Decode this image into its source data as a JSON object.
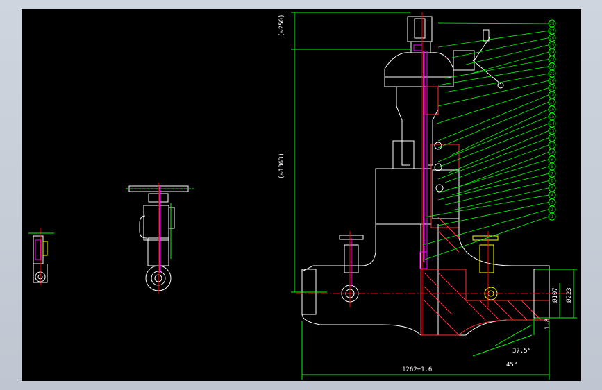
{
  "drawing": {
    "background": "#000000",
    "colors": {
      "outline": "#ffffff",
      "dimension": "#00ff00",
      "centerline": "#ff0000",
      "stem": "#ff00ff",
      "hatch": "#ff3030",
      "highlight": "#ffff00"
    },
    "dimensions": {
      "top_height": "(≈250)",
      "body_height": "(≈1363)",
      "overall_length": "1262±1.6",
      "bore_diameter": "Ø107",
      "outer_diameter": "Ø223",
      "wall_step": "1.8",
      "bevel_angle": "37.5°",
      "chamfer_angle": "45°"
    },
    "balloons": [
      "28",
      "27",
      "26",
      "25",
      "24",
      "23",
      "22",
      "21",
      "20",
      "19",
      "18",
      "17",
      "16",
      "15",
      "14",
      "13",
      "12",
      "11",
      "10",
      "9",
      "8",
      "7",
      "6",
      "5",
      "4",
      "3",
      "2",
      "1"
    ]
  }
}
